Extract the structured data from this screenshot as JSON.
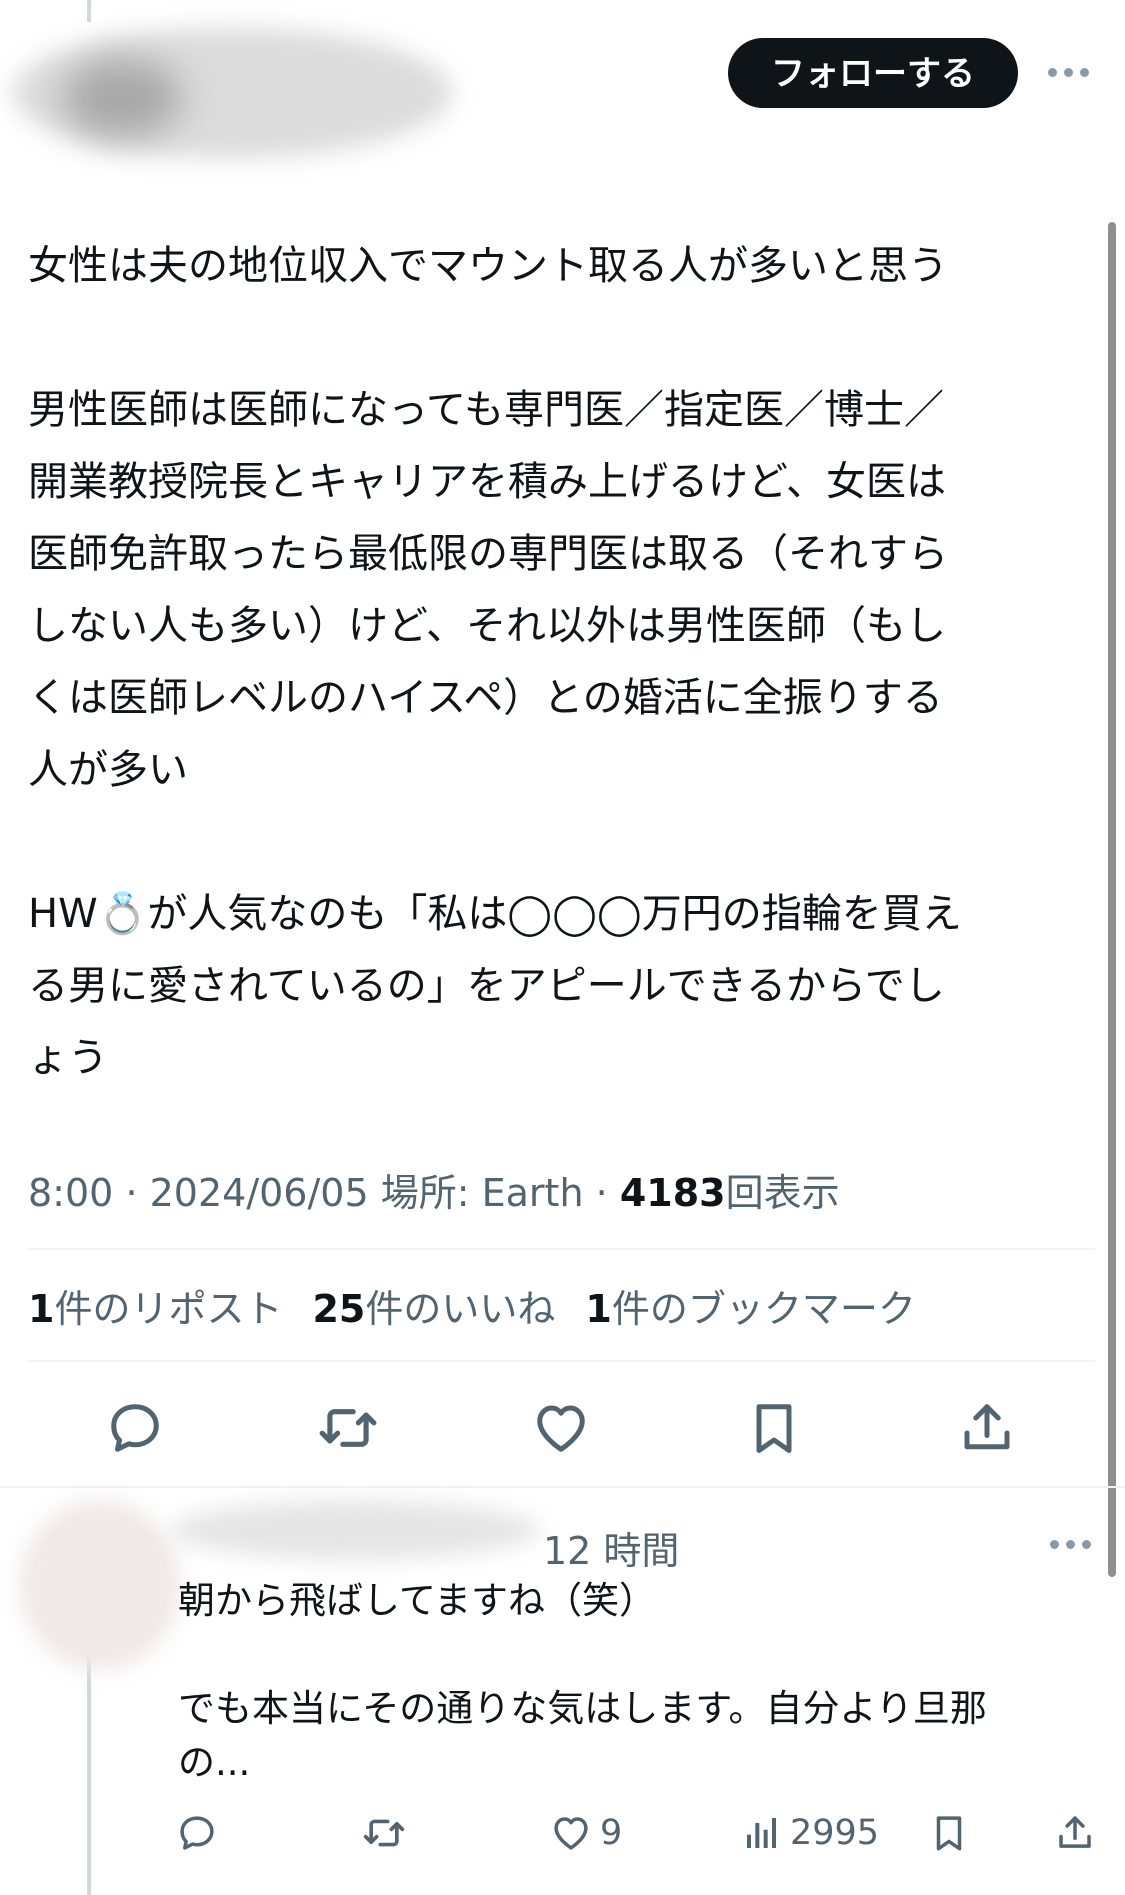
{
  "header": {
    "follow_label": "フォローする",
    "more_icon": "more-icon"
  },
  "post": {
    "paragraphs": [
      [
        "女性は夫の地位収入でマウント取る人が多いと思う"
      ],
      [
        "男性医師は医師になっても専門医／指定医／博士／",
        "開業教授院長とキャリアを積み上げるけど、女医は",
        "医師免許取ったら最低限の専門医は取る（それすら",
        "しない人も多い）けど、それ以外は男性医師（もし",
        "くは医師レベルのハイスペ）との婚活に全振りする",
        "人が多い"
      ],
      [
        "HW💍が人気なのも「私は◯◯◯万円の指輪を買え",
        "る男に愛されているの」をアピールできるからでし",
        "ょう"
      ]
    ],
    "meta": {
      "time": "8:00",
      "sep1": "·",
      "date": "2024/06/05",
      "location_label": "場所: Earth",
      "sep2": "·",
      "views": "4183",
      "views_label": "回表示"
    },
    "stats": {
      "reposts_count": "1",
      "reposts_label": "件のリポスト",
      "likes_count": "25",
      "likes_label": "件のいいね",
      "bookmarks_count": "1",
      "bookmarks_label": "件のブックマーク"
    },
    "actions": [
      "reply-icon",
      "repost-icon",
      "like-icon",
      "bookmark-icon",
      "share-icon"
    ]
  },
  "reply": {
    "time": "12 時間",
    "lines": [
      "朝から飛ばしてますね（笑）",
      "",
      "でも本当にその通りな気はします。自分より旦那",
      "の..."
    ],
    "likes": "9",
    "views": "2995"
  },
  "colors": {
    "text": "#0f1419",
    "secondary": "#536471",
    "divider": "#eff3f4",
    "follow_bg": "#0f1419"
  }
}
